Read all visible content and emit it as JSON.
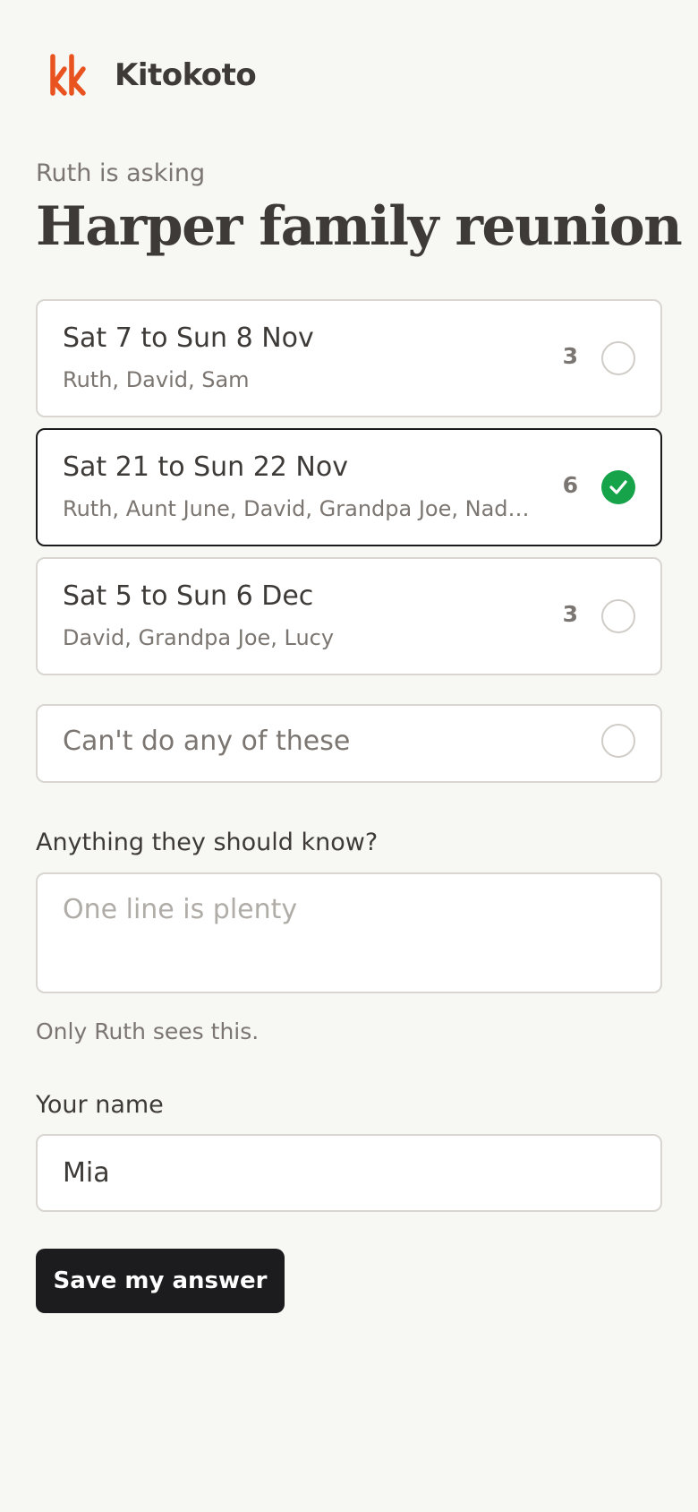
{
  "brand": {
    "name": "Kitokoto",
    "accent": "#e8531f"
  },
  "poll": {
    "asker_line": "Ruth is asking",
    "title": "Harper family reunion"
  },
  "options": [
    {
      "date": "Sat 7 to Sun 8 Nov",
      "people": "Ruth, David, Sam",
      "count": "3",
      "selected": false
    },
    {
      "date": "Sat 21 to Sun 22 Nov",
      "people": "Ruth, Aunt June, David, Grandpa Joe, Nad…",
      "count": "6",
      "selected": true
    },
    {
      "date": "Sat 5 to Sun 6 Dec",
      "people": "David, Grandpa Joe, Lucy",
      "count": "3",
      "selected": false
    }
  ],
  "none_option": {
    "label": "Can't do any of these",
    "selected": false
  },
  "note": {
    "label": "Anything they should know?",
    "placeholder": "One line is plenty",
    "value": "",
    "helper": "Only Ruth sees this."
  },
  "name_field": {
    "label": "Your name",
    "value": "Mia"
  },
  "submit": {
    "label": "Save my answer"
  },
  "colors": {
    "selected_check": "#16a34a",
    "button_bg": "#1c1c1e",
    "background": "#f7f7f4"
  }
}
